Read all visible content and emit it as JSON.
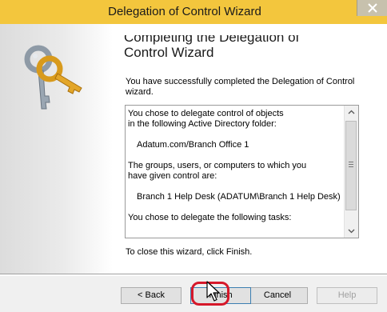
{
  "window": {
    "title": "Delegation of Control Wizard"
  },
  "wizard": {
    "heading_line1": "Completing the Delegation of",
    "heading_line2": "Control Wizard",
    "success_message": "You have successfully completed the Delegation of Control wizard.",
    "summary": {
      "line1": "You chose to delegate control of objects",
      "line2": "in the following Active Directory folder:",
      "folder": "Adatum.com/Branch Office 1",
      "line3": "The groups, users, or computers to which you",
      "line4": "have given control are:",
      "group": "Branch 1 Help Desk (ADATUM\\Branch 1 Help Desk)",
      "line5": "You chose to delegate the following tasks:"
    },
    "close_instruction": "To close this wizard, click Finish."
  },
  "buttons": {
    "back": "< Back",
    "finish": "Finish",
    "cancel": "Cancel",
    "help": "Help"
  },
  "icons": {
    "keys": "keys-icon",
    "close": "close-icon",
    "cursor": "mouse-cursor-icon"
  },
  "colors": {
    "titlebar": "#f3c63d",
    "highlight": "#d6182a"
  }
}
